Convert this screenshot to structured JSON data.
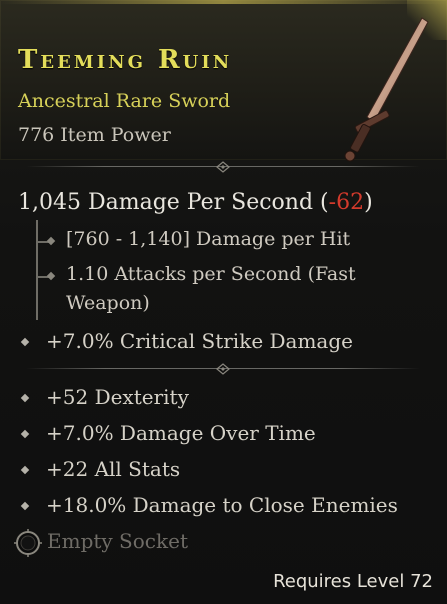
{
  "item": {
    "name": "Teeming Ruin",
    "type": "Ancestral Rare Sword",
    "item_power": "776 Item Power",
    "requires": "Requires Level 72"
  },
  "dps": {
    "value": "1,045 Damage Per Second",
    "open": " (",
    "delta": "-62",
    "close": ")"
  },
  "weapon_stats": [
    "[760 - 1,140] Damage per Hit",
    "1.10 Attacks per Second (Fast",
    "Weapon)"
  ],
  "implicit": "+7.0% Critical Strike Damage",
  "affixes": [
    "+52 Dexterity",
    "+7.0% Damage Over Time",
    "+22 All Stats",
    "+18.0% Damage to Close Enemies"
  ],
  "socket": {
    "label": "Empty Socket",
    "icon": "empty-socket-icon"
  },
  "colors": {
    "rare_yellow": "#e3dd5a",
    "negative_red": "#d33a2c",
    "text_light": "#e9e6de",
    "muted": "#6f6c66"
  },
  "icons": {
    "item_image": "sword-icon",
    "bullet": "diamond-bullet-icon",
    "divider": "divider-ornament-icon"
  }
}
